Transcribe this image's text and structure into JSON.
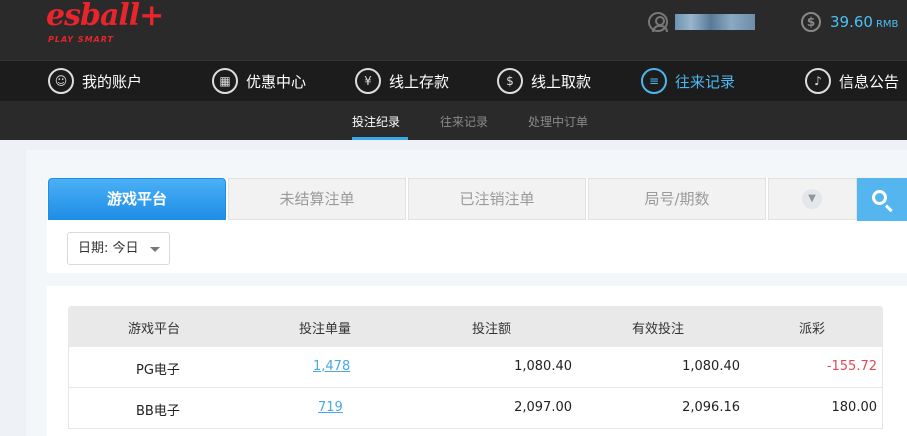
{
  "header": {
    "logo_text": "esball+",
    "logo_tagline": "PLAY SMART",
    "balance": "39.60",
    "currency": "RMB"
  },
  "main_nav": {
    "items": [
      {
        "label": "我的账户",
        "icon": "user-icon"
      },
      {
        "label": "优惠中心",
        "icon": "gift-icon"
      },
      {
        "label": "线上存款",
        "icon": "deposit-icon"
      },
      {
        "label": "线上取款",
        "icon": "withdraw-icon"
      },
      {
        "label": "往来记录",
        "icon": "records-icon",
        "active": true
      },
      {
        "label": "信息公告",
        "icon": "bell-icon"
      }
    ]
  },
  "sub_nav": {
    "items": [
      {
        "label": "投注纪录",
        "active": true
      },
      {
        "label": "往来记录"
      },
      {
        "label": "处理中订单"
      }
    ]
  },
  "filter": {
    "tabs": [
      {
        "label": "游戏平台",
        "active": true
      },
      {
        "label": "未结算注单"
      },
      {
        "label": "已注销注单"
      },
      {
        "label": "局号/期数"
      }
    ],
    "date_label": "日期: 今日"
  },
  "table": {
    "headers": [
      "游戏平台",
      "投注单量",
      "投注额",
      "有效投注",
      "派彩"
    ],
    "rows": [
      {
        "platform": "PG电子",
        "count": "1,478",
        "amount": "1,080.40",
        "valid": "1,080.40",
        "payout": "-155.72"
      },
      {
        "platform": "BB电子",
        "count": "719",
        "amount": "2,097.00",
        "valid": "2,096.16",
        "payout": "180.00"
      }
    ]
  },
  "colors": {
    "accent": "#3aa8e8",
    "brand_red": "#e8242c",
    "negative": "#e04a58"
  }
}
